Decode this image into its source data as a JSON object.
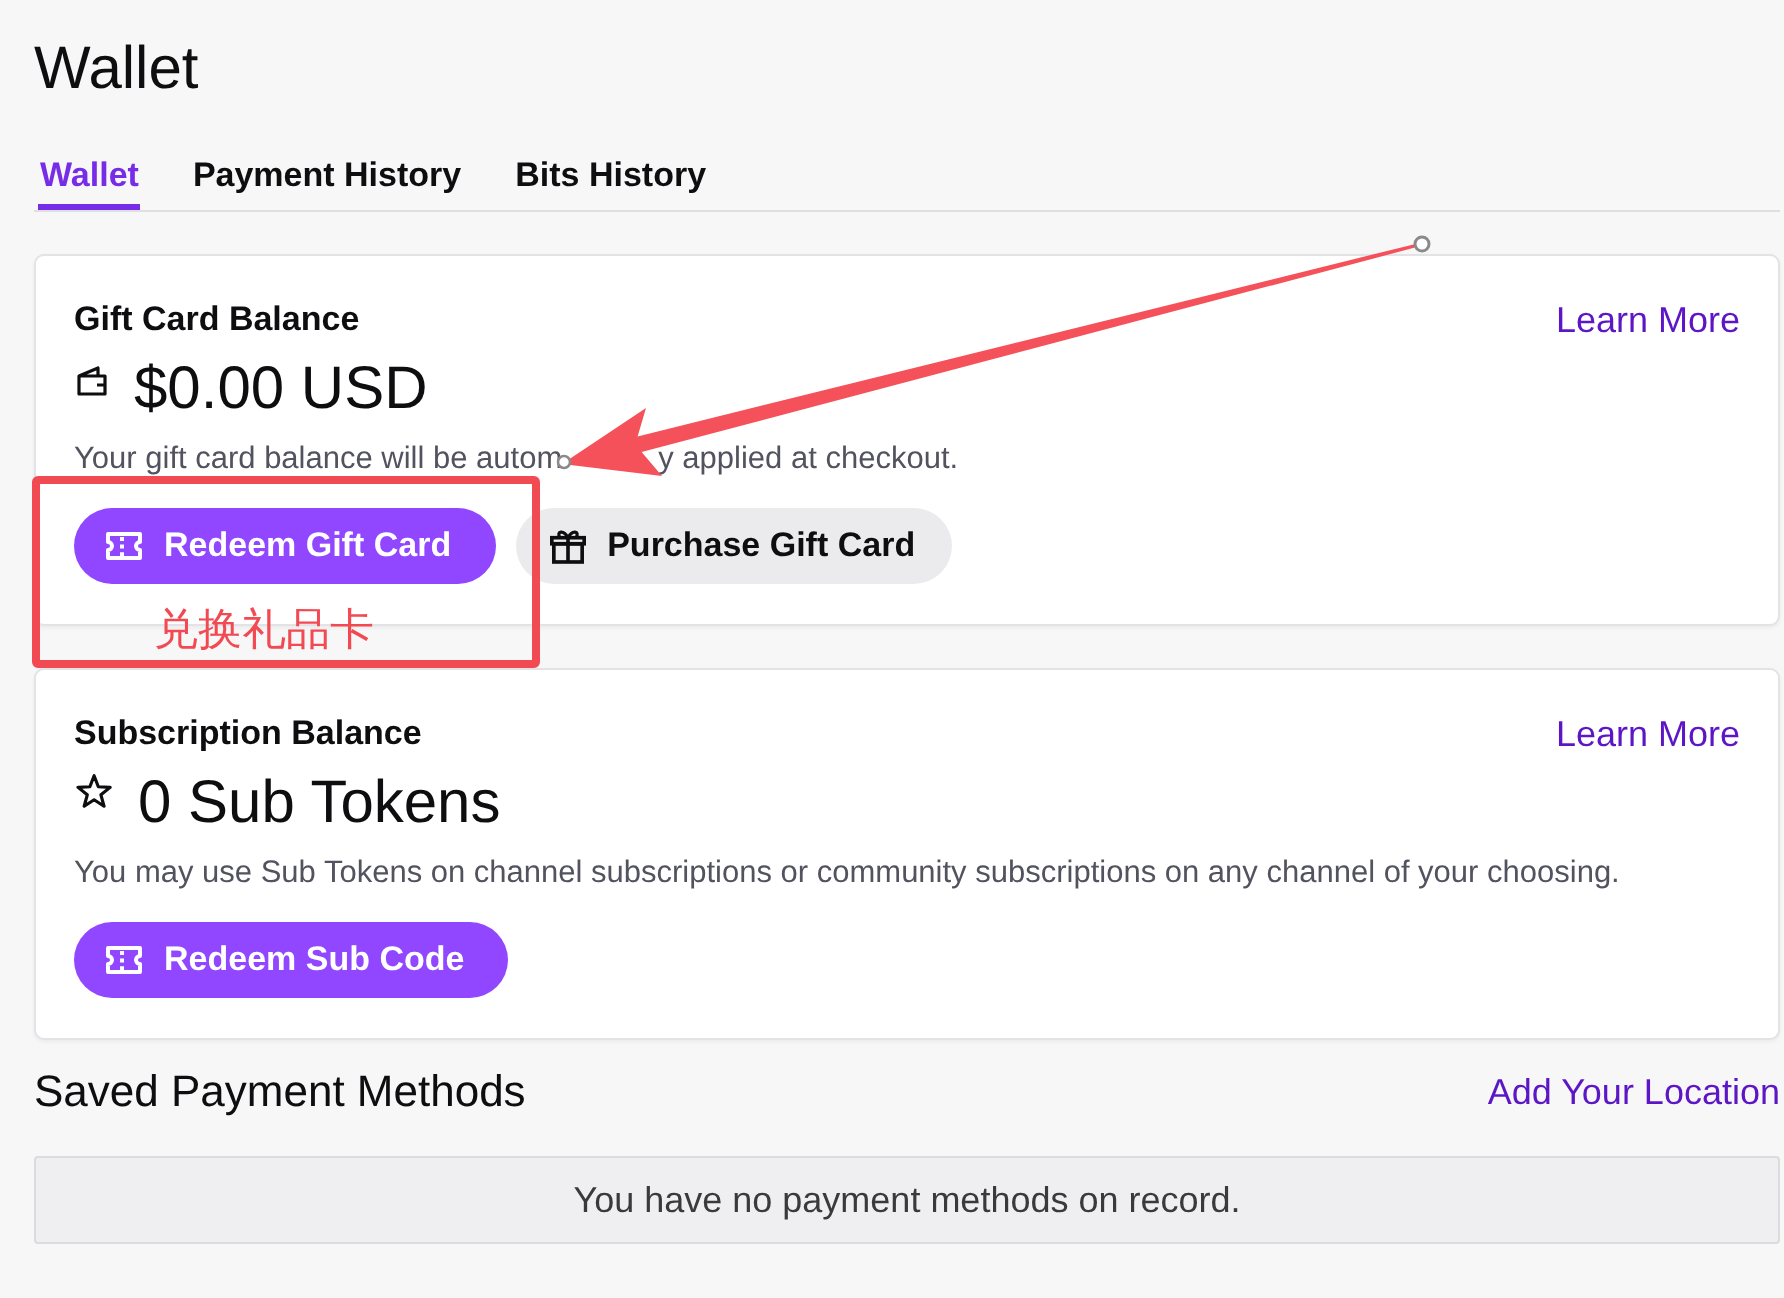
{
  "title": "Wallet",
  "tabs": [
    {
      "label": "Wallet",
      "selected": true
    },
    {
      "label": "Payment History",
      "selected": false
    },
    {
      "label": "Bits History",
      "selected": false
    }
  ],
  "cards": [
    {
      "kind": "gift_card",
      "heading": "Gift Card Balance",
      "link": "Learn More",
      "balance": "$0.00 USD",
      "description": [
        "Your gift card balance will be autom",
        "y applied at checkout."
      ],
      "buttons": [
        {
          "kind": "primary",
          "label": "Redeem Gift Card"
        },
        {
          "kind": "secondary",
          "label": "Purchase Gift Card"
        }
      ],
      "annotation": {
        "label": "兑换礼品卡"
      }
    },
    {
      "kind": "subscription",
      "heading": "Subscription Balance",
      "link": "Learn More",
      "balance": "0 Sub Tokens",
      "description": [
        "You may use Sub Tokens on channel subscriptions or community subscriptions on any channel of your choosing."
      ],
      "buttons": [
        {
          "kind": "primary",
          "label": "Redeem Sub Code"
        }
      ]
    }
  ],
  "payment_methods": {
    "heading": "Saved Payment Methods",
    "link": "Add Your Location",
    "empty_message": "You have no payment methods on record."
  }
}
